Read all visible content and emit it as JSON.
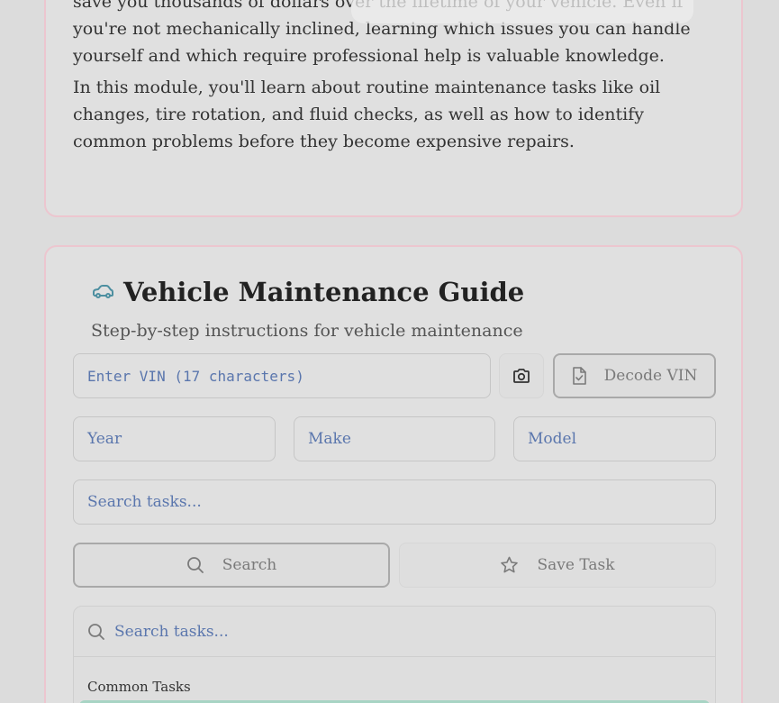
{
  "intro": {
    "paragraph_1": "save you thousands of dollars over the lifetime of your vehicle. Even if you're not mechanically inclined, learning which issues you can handle yourself and which require professional help is valuable knowledge.",
    "paragraph_2": "In this module, you'll learn about routine maintenance tasks like oil changes, tire rotation, and fluid checks, as well as how to identify common problems before they become expensive repairs."
  },
  "guide": {
    "title": "Vehicle Maintenance Guide",
    "subtitle": "Step-by-step instructions for vehicle maintenance",
    "title_icon": "car-icon",
    "vin": {
      "placeholder": "Enter VIN (17 characters)"
    },
    "camera_icon": "camera-icon",
    "decode_button": {
      "label": "Decode VIN",
      "icon": "file-check-icon"
    },
    "year": {
      "placeholder": "Year"
    },
    "make": {
      "placeholder": "Make"
    },
    "model": {
      "placeholder": "Model"
    },
    "task_search": {
      "placeholder": "Search tasks..."
    },
    "search_button": {
      "label": "Search",
      "icon": "search-icon"
    },
    "save_button": {
      "label": "Save Task",
      "icon": "star-icon"
    },
    "task_panel": {
      "search_placeholder": "Search tasks...",
      "section_heading": "Common Tasks"
    }
  },
  "colors": {
    "accent_icon": "#4d8fa0",
    "placeholder_text": "#5a76ad",
    "card_border": "#ecc6cf",
    "selected_strip": "#a8d4c4"
  }
}
